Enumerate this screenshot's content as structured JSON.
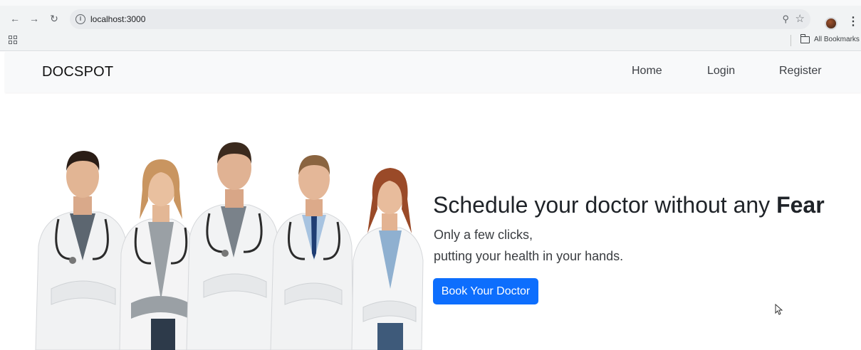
{
  "browser": {
    "url": "localhost:3000",
    "bookmarks_label": "All Bookmarks",
    "icons": [
      "back-arrow-icon",
      "forward-arrow-icon",
      "reload-icon",
      "site-info-icon",
      "zoom-icon",
      "star-icon",
      "menu-dots-icon",
      "apps-grid-icon",
      "folder-icon"
    ]
  },
  "navbar": {
    "brand": "DOCSPOT",
    "links": [
      "Home",
      "Login",
      "Register"
    ]
  },
  "hero": {
    "headline_normal": "Schedule your doctor without any ",
    "headline_bold": "Fear",
    "line1": "Only a few clicks,",
    "line2": "putting your health in your hands.",
    "cta_label": "Book Your Doctor",
    "image_alt": "group-of-doctors-image"
  },
  "colors": {
    "primary": "#0d6efd",
    "navbar_bg": "#f8f9fa",
    "chrome_bg": "#f1f3f4"
  }
}
